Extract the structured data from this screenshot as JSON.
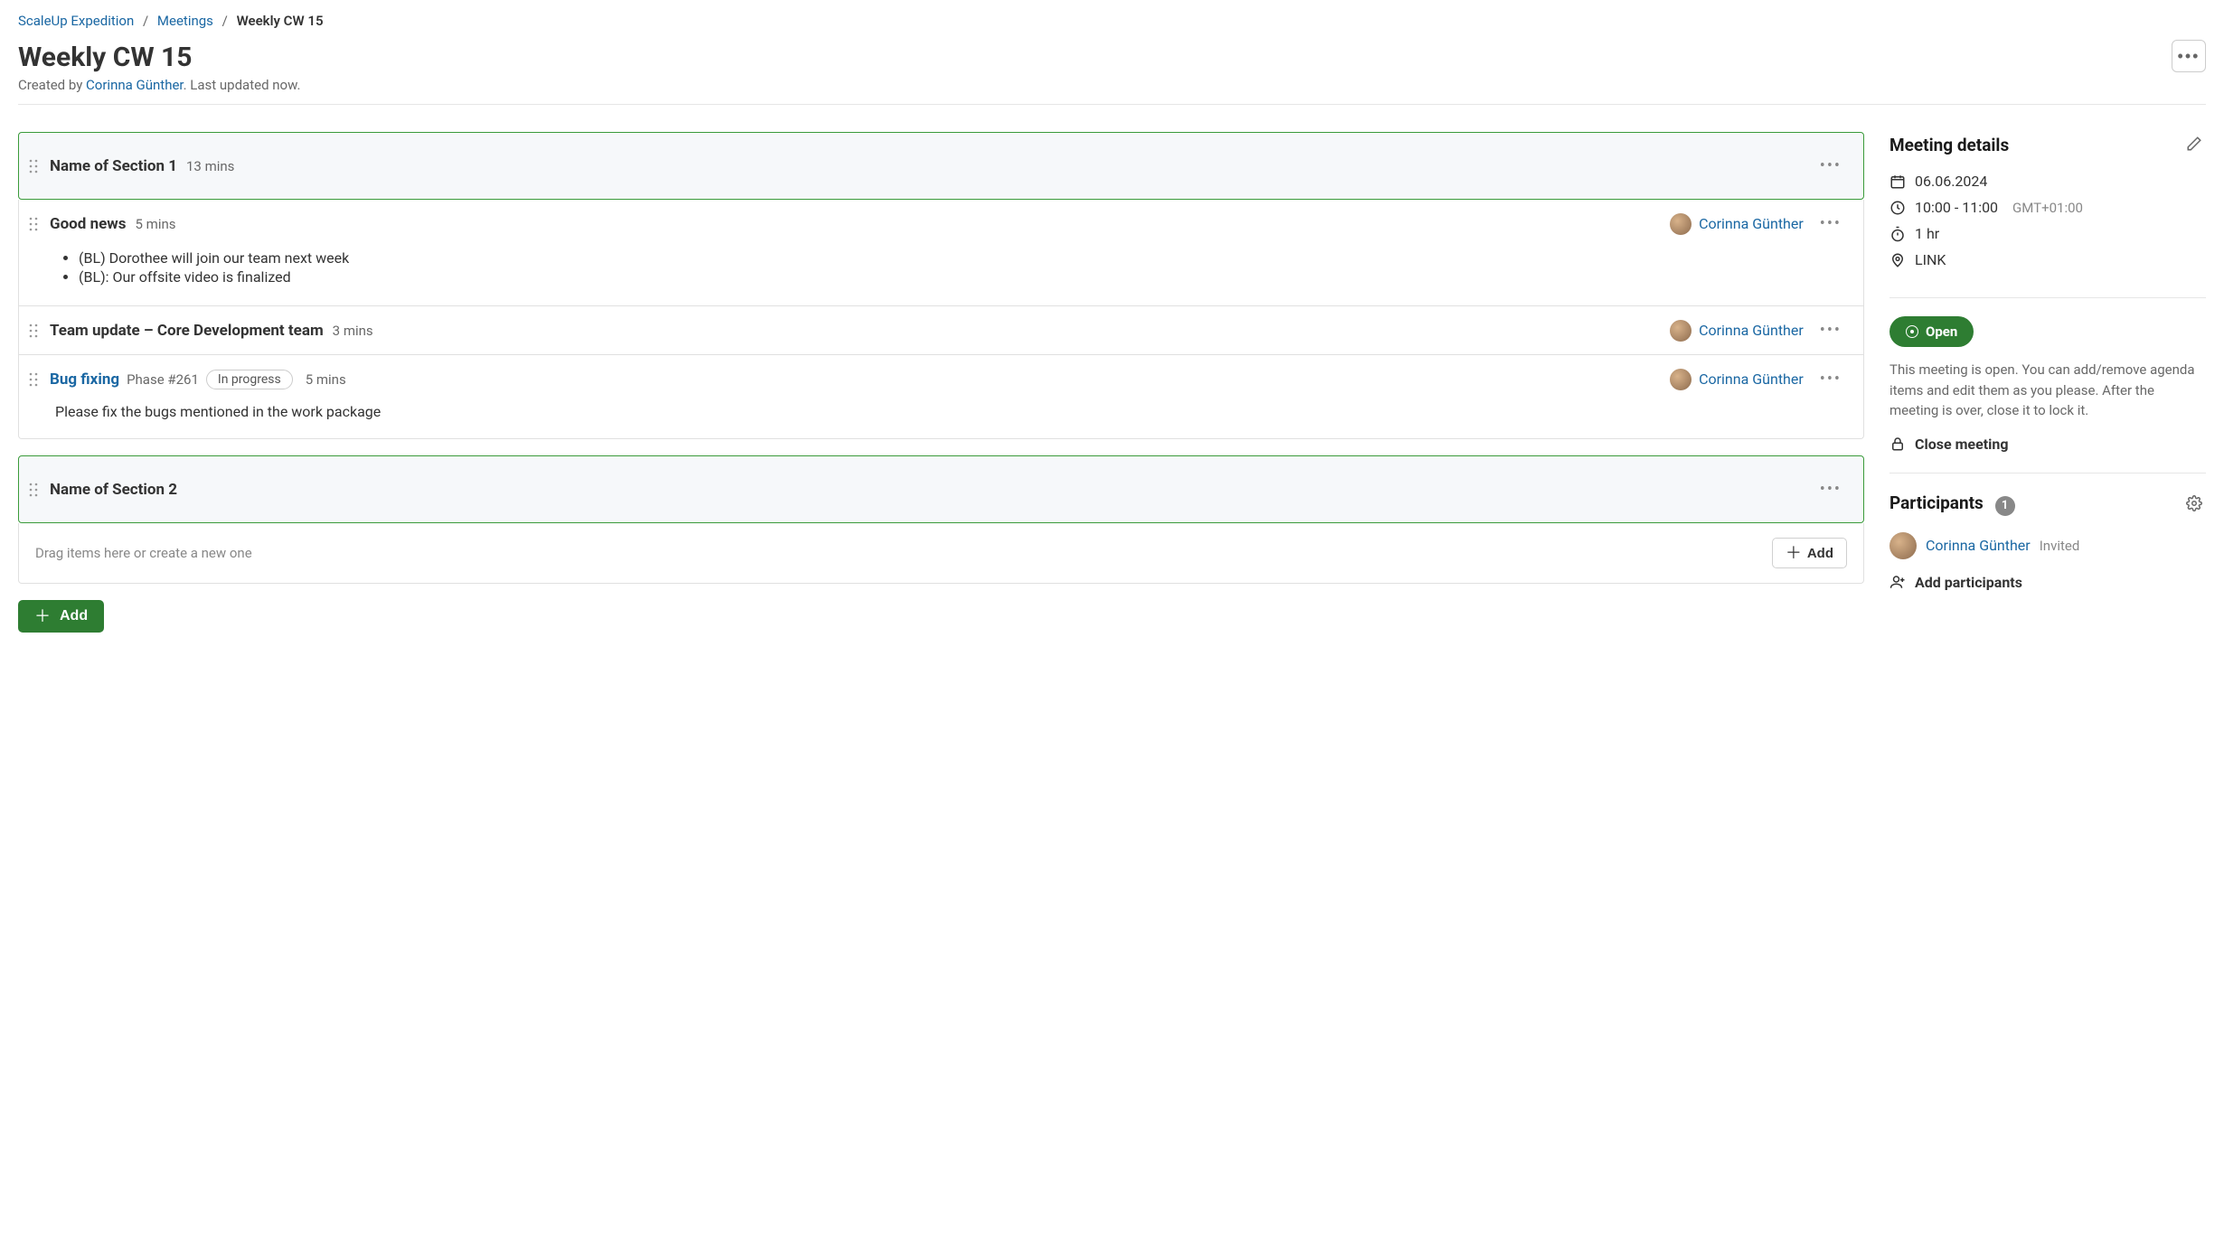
{
  "breadcrumbs": {
    "project": "ScaleUp Expedition",
    "parent": "Meetings",
    "current": "Weekly CW 15"
  },
  "page": {
    "title": "Weekly CW 15",
    "created_by_prefix": "Created by ",
    "created_by": "Corinna Günther",
    "created_by_suffix": ".",
    "updated": " Last updated now."
  },
  "sections": [
    {
      "title": "Name of Section 1",
      "duration": "13 mins"
    },
    {
      "title": "Name of Section 2",
      "duration": ""
    }
  ],
  "items": [
    {
      "title": "Good news",
      "duration": "5 mins",
      "presenter": "Corinna Günther",
      "body": [
        "(BL) Dorothee will join our team next week",
        "(BL): Our offsite video is finalized"
      ]
    },
    {
      "title": "Team update – Core Development team",
      "duration": "3 mins",
      "presenter": "Corinna Günther"
    },
    {
      "title": "Bug fixing",
      "phase": "Phase #261",
      "status_chip": "In progress",
      "duration": "5 mins",
      "presenter": "Corinna Günther",
      "body_text": "Please fix the bugs mentioned in the work package"
    }
  ],
  "dropzone": {
    "placeholder": "Drag items here or create a new one",
    "add": "Add"
  },
  "add_button": "Add",
  "sidebar": {
    "details": {
      "heading": "Meeting details",
      "date": "06.06.2024",
      "time": "10:00 - 11:00",
      "tz": "GMT+01:00",
      "duration": "1 hr",
      "location": "LINK"
    },
    "state": {
      "badge": "Open",
      "text": "This meeting is open. You can add/remove agenda items and edit them as you please. After the meeting is over, close it to lock it.",
      "close": "Close meeting"
    },
    "participants": {
      "heading": "Participants",
      "count": "1",
      "list": [
        {
          "name": "Corinna Günther",
          "status": "Invited"
        }
      ],
      "add": "Add participants"
    }
  }
}
